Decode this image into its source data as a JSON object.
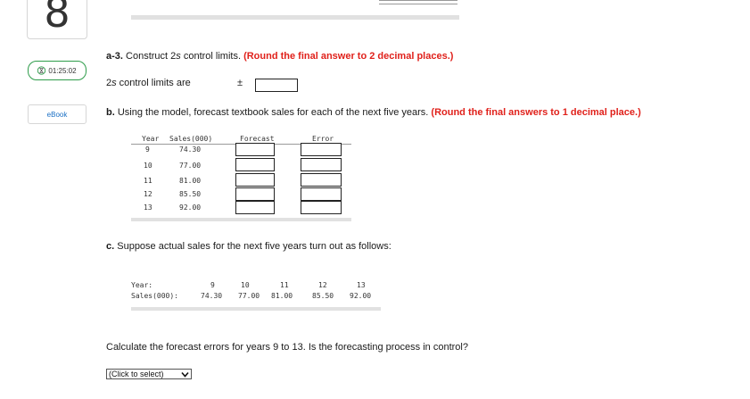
{
  "rail": {
    "question_number": "8",
    "timer": "01:25:02",
    "ebook": "eBook"
  },
  "a3": {
    "label": "a-3.",
    "text_prefix": " Construct 2",
    "text_italic": "s",
    "text_suffix": " control limits. ",
    "instruction": "(Round the final answer to 2 decimal places.)",
    "limits_prefix": "2",
    "limits_italic": "s",
    "limits_suffix": " control limits are",
    "plus_minus": "±"
  },
  "b": {
    "label": "b.",
    "text": " Using the model, forecast textbook sales for each of the next five years. ",
    "instruction": "(Round the final answers to 1 decimal place.)",
    "headers": [
      "Year",
      "Sales(000)",
      "Forecast",
      "Error"
    ],
    "rows": [
      {
        "year": "9",
        "sales": "74.30"
      },
      {
        "year": "10",
        "sales": "77.00"
      },
      {
        "year": "11",
        "sales": "81.00"
      },
      {
        "year": "12",
        "sales": "85.50"
      },
      {
        "year": "13",
        "sales": "92.00"
      }
    ]
  },
  "c": {
    "label": "c.",
    "text": " Suppose actual sales for the next five years turn out as follows:",
    "year_label": "Year:",
    "sales_label": "Sales(000):",
    "years": [
      "9",
      "10",
      "11",
      "12",
      "13"
    ],
    "sales": [
      "74.30",
      "77.00",
      "81.00",
      "85.50",
      "92.00"
    ],
    "question": "Calculate the forecast errors for years 9 to 13. Is the forecasting process in control?",
    "select_value": "(Click to select)"
  }
}
